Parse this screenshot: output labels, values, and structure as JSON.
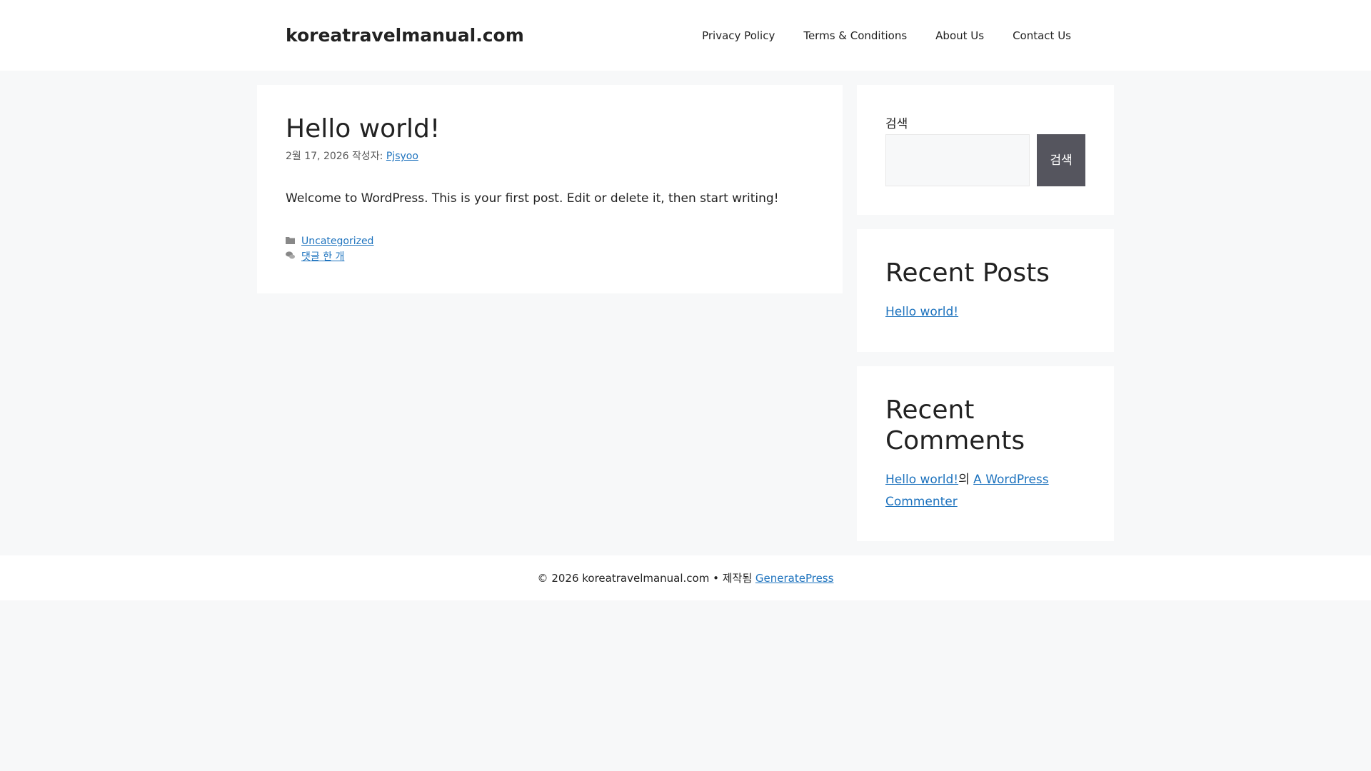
{
  "header": {
    "site_title": "koreatravelmanual.com",
    "nav": [
      "Privacy Policy",
      "Terms & Conditions",
      "About Us",
      "Contact Us"
    ]
  },
  "post": {
    "title": "Hello world!",
    "date": "2월 17, 2026",
    "by": " 작성자: ",
    "author": "Pjsyoo",
    "content": "Welcome to WordPress. This is your first post. Edit or delete it, then start writing!",
    "category": "Uncategorized",
    "comments": "댓글 한 개"
  },
  "sidebar": {
    "search_label": "검색",
    "search_button": "검색",
    "search_value": "",
    "recent_posts_title": "Recent Posts",
    "recent_posts": [
      "Hello world!"
    ],
    "recent_comments_title": "Recent Comments",
    "comment": {
      "post": "Hello world!",
      "sep": "의 ",
      "author": "A WordPress Commenter"
    }
  },
  "footer": {
    "copyright": "© 2026 koreatravelmanual.com • 제작됨 ",
    "link": "GeneratePress"
  }
}
